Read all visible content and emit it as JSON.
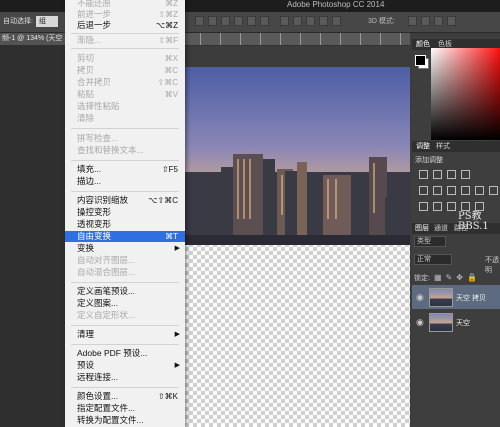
{
  "app": {
    "title": "Adobe Photoshop CC 2014"
  },
  "options_bar": {
    "auto_select_label": "自动选择:",
    "auto_select_value": "组",
    "mode_3d_label": "3D 模式:"
  },
  "document": {
    "tab_title": "频-1 @ 134% (天空"
  },
  "panels": {
    "color_tabs": [
      "颜色",
      "色板"
    ],
    "adjust_tabs": [
      "调整",
      "样式"
    ],
    "adjust_label": "添加调整",
    "layers_tabs": [
      "图层",
      "通道",
      "路径"
    ],
    "filter_type": "类型",
    "blend_mode": "正常",
    "opacity_label": "不透明",
    "lock_label": "锁定:",
    "layers": [
      {
        "name": "天空 拷贝",
        "selected": true
      },
      {
        "name": "天空",
        "selected": false
      }
    ],
    "watermark": [
      "PS教",
      "BBS.1"
    ]
  },
  "edit_menu": {
    "items": [
      {
        "label": "不能还原",
        "shortcut": "⌘Z",
        "disabled": true
      },
      {
        "label": "前进一步",
        "shortcut": "⇧⌘Z",
        "disabled": true
      },
      {
        "label": "后退一步",
        "shortcut": "⌥⌘Z",
        "disabled": false
      },
      {
        "label": "渐隐...",
        "shortcut": "⇧⌘F",
        "disabled": true
      },
      {
        "label": "剪切",
        "shortcut": "⌘X",
        "disabled": true
      },
      {
        "label": "拷贝",
        "shortcut": "⌘C",
        "disabled": true
      },
      {
        "label": "合并拷贝",
        "shortcut": "⇧⌘C",
        "disabled": true
      },
      {
        "label": "粘贴",
        "shortcut": "⌘V",
        "disabled": true
      },
      {
        "label": "选择性粘贴",
        "shortcut": "",
        "disabled": true
      },
      {
        "label": "清除",
        "shortcut": "",
        "disabled": true
      },
      {
        "label": "拼写检查...",
        "shortcut": "",
        "disabled": true
      },
      {
        "label": "查找和替换文本...",
        "shortcut": "",
        "disabled": true
      },
      {
        "label": "填充...",
        "shortcut": "⇧F5",
        "disabled": false
      },
      {
        "label": "描边...",
        "shortcut": "",
        "disabled": false
      },
      {
        "label": "内容识别缩放",
        "shortcut": "⌥⇧⌘C",
        "disabled": false
      },
      {
        "label": "操控变形",
        "shortcut": "",
        "disabled": false
      },
      {
        "label": "透视变形",
        "shortcut": "",
        "disabled": false
      },
      {
        "label": "自由变换",
        "shortcut": "⌘T",
        "disabled": false,
        "highlighted": true
      },
      {
        "label": "变换",
        "shortcut": "",
        "disabled": false,
        "submenu": true
      },
      {
        "label": "自动对齐图层...",
        "shortcut": "",
        "disabled": true
      },
      {
        "label": "自动混合图层...",
        "shortcut": "",
        "disabled": true
      },
      {
        "label": "定义画笔预设...",
        "shortcut": "",
        "disabled": false
      },
      {
        "label": "定义图案...",
        "shortcut": "",
        "disabled": false
      },
      {
        "label": "定义自定形状...",
        "shortcut": "",
        "disabled": true
      },
      {
        "label": "清理",
        "shortcut": "",
        "disabled": false,
        "submenu": true
      },
      {
        "label": "Adobe PDF 预设...",
        "shortcut": "",
        "disabled": false
      },
      {
        "label": "预设",
        "shortcut": "",
        "disabled": false,
        "submenu": true
      },
      {
        "label": "远程连接...",
        "shortcut": "",
        "disabled": false
      },
      {
        "label": "颜色设置...",
        "shortcut": "⇧⌘K",
        "disabled": false
      },
      {
        "label": "指定配置文件...",
        "shortcut": "",
        "disabled": false
      },
      {
        "label": "转换为配置文件...",
        "shortcut": "",
        "disabled": false
      }
    ]
  }
}
